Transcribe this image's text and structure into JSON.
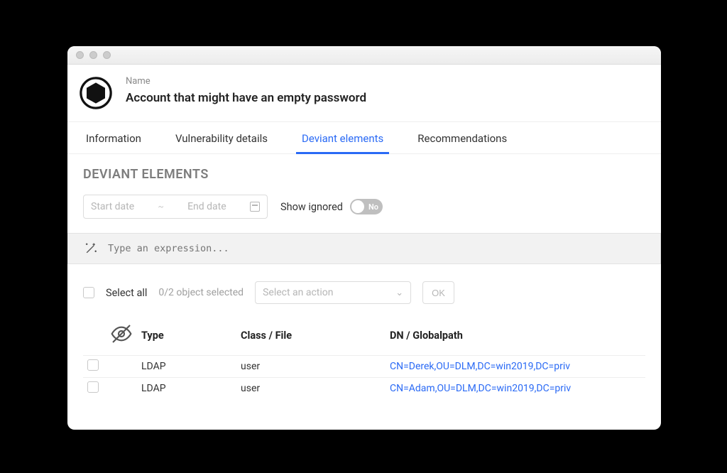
{
  "header": {
    "name_label": "Name",
    "title": "Account that might have an empty password"
  },
  "tabs": [
    {
      "id": "information",
      "label": "Information",
      "active": false
    },
    {
      "id": "vuln-details",
      "label": "Vulnerability details",
      "active": false
    },
    {
      "id": "deviant",
      "label": "Deviant elements",
      "active": true
    },
    {
      "id": "recommendations",
      "label": "Recommendations",
      "active": false
    }
  ],
  "section_title": "DEVIANT ELEMENTS",
  "date_range": {
    "start_placeholder": "Start date",
    "end_placeholder": "End date"
  },
  "show_ignored": {
    "label": "Show ignored",
    "state_text": "No",
    "value": false
  },
  "expression": {
    "placeholder": "Type an expression..."
  },
  "selection": {
    "select_all_label": "Select all",
    "count_text": "0/2 object selected",
    "action_placeholder": "Select an action",
    "ok_label": "OK"
  },
  "table": {
    "columns": {
      "type": "Type",
      "class_file": "Class / File",
      "dn": "DN / Globalpath"
    },
    "rows": [
      {
        "type": "LDAP",
        "class": "user",
        "dn": "CN=Derek,OU=DLM,DC=win2019,DC=priv"
      },
      {
        "type": "LDAP",
        "class": "user",
        "dn": "CN=Adam,OU=DLM,DC=win2019,DC=priv"
      }
    ]
  }
}
